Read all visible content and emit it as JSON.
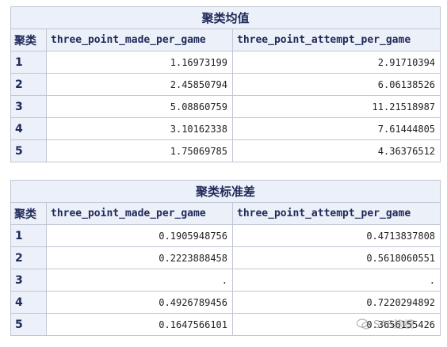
{
  "means_table": {
    "title": "聚类均值",
    "headers": [
      "聚类",
      "three_point_made_per_game",
      "three_point_attempt_per_game"
    ],
    "rows": [
      {
        "cluster": "1",
        "made": "1.16973199",
        "attempt": "2.91710394"
      },
      {
        "cluster": "2",
        "made": "2.45850794",
        "attempt": "6.06138526"
      },
      {
        "cluster": "3",
        "made": "5.08860759",
        "attempt": "11.21518987"
      },
      {
        "cluster": "4",
        "made": "3.10162338",
        "attempt": "7.61444805"
      },
      {
        "cluster": "5",
        "made": "1.75069785",
        "attempt": "4.36376512"
      }
    ]
  },
  "std_table": {
    "title": "聚类标准差",
    "headers": [
      "聚类",
      "three_point_made_per_game",
      "three_point_attempt_per_game"
    ],
    "rows": [
      {
        "cluster": "1",
        "made": "0.1905948756",
        "attempt": "0.4713837808"
      },
      {
        "cluster": "2",
        "made": "0.2223888458",
        "attempt": "0.5618060551"
      },
      {
        "cluster": "3",
        "made": ".",
        "attempt": "."
      },
      {
        "cluster": "4",
        "made": "0.4926789456",
        "attempt": "0.7220294892"
      },
      {
        "cluster": "5",
        "made": "0.1647566101",
        "attempt": "0.3656155426"
      }
    ]
  },
  "watermark": {
    "text": "SAS建模"
  }
}
